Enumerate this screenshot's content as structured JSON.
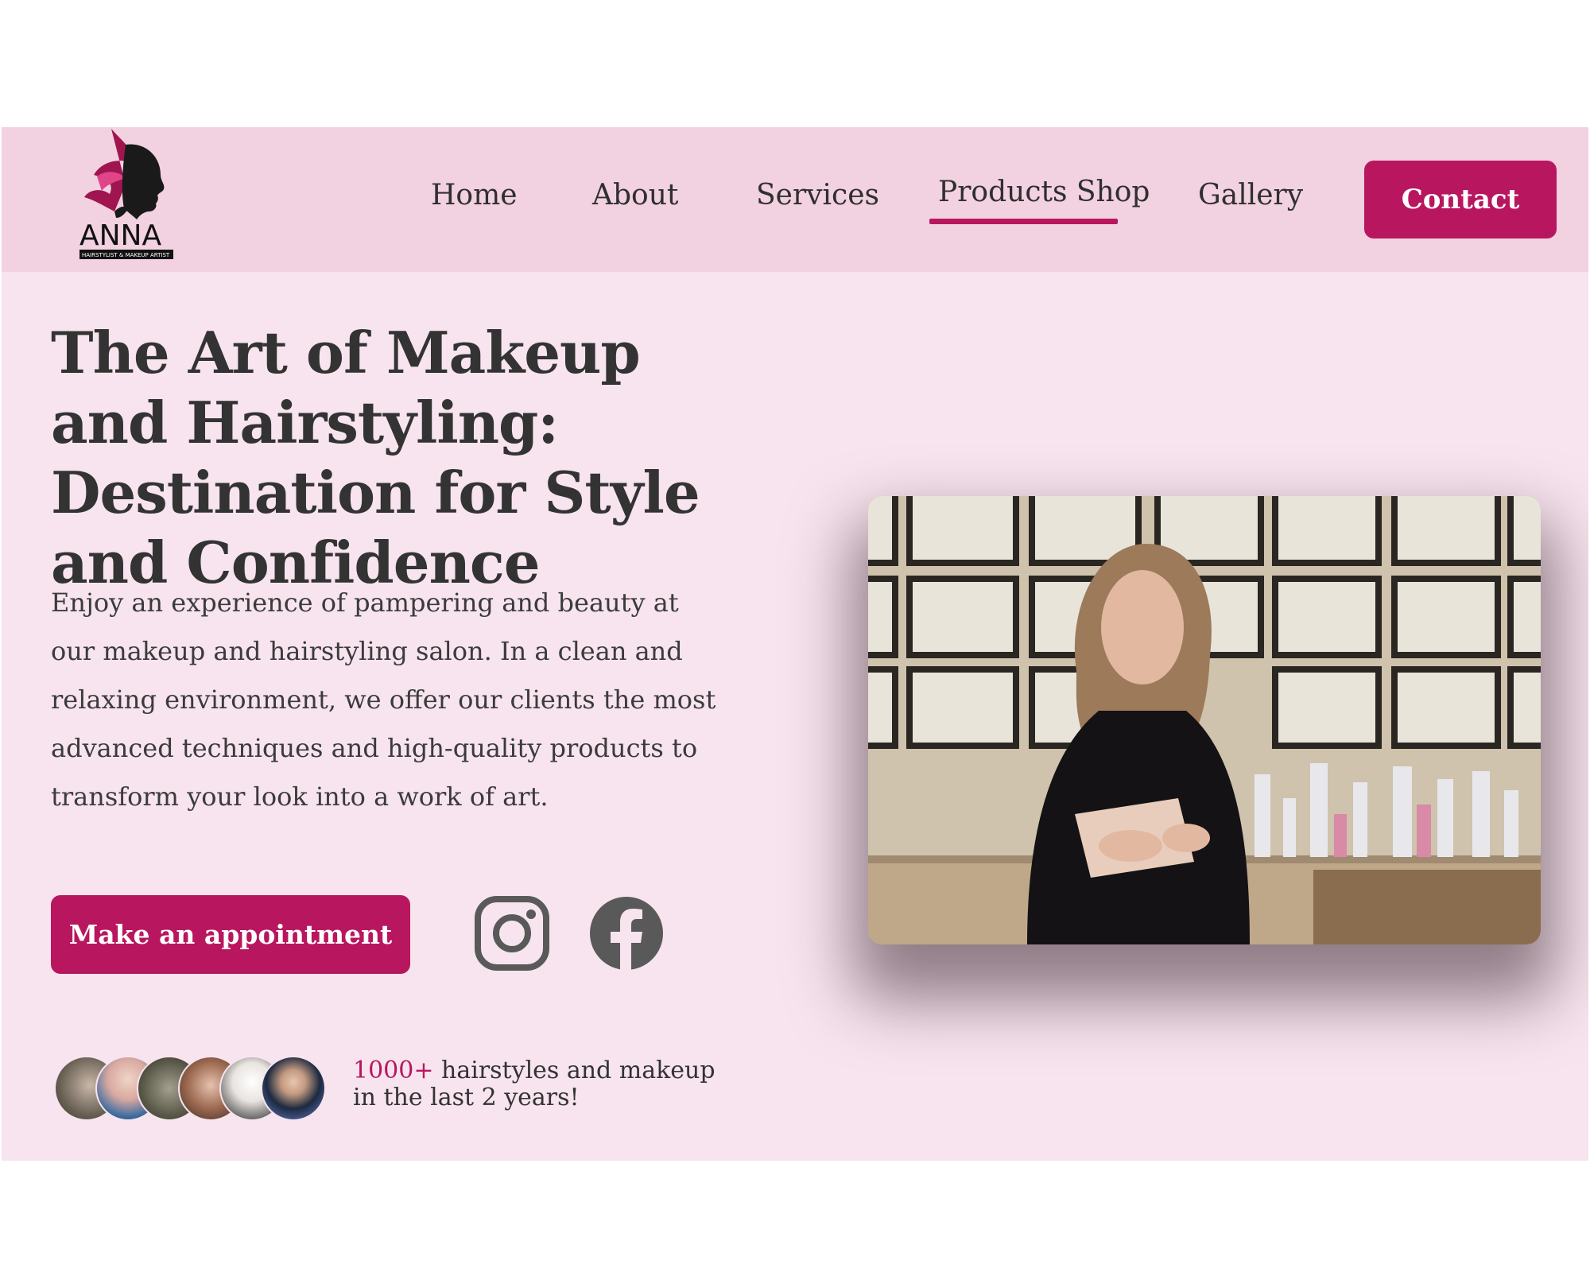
{
  "brand": {
    "name": "ANNA",
    "tagline": "HAIRSTYLIST & MAKEUP ARTIST",
    "accent_color": "#b8175f",
    "nav_bg_color": "#f2d1e0",
    "page_bg_color": "#f7e4ee"
  },
  "nav": {
    "items": [
      {
        "label": "Home",
        "active": false
      },
      {
        "label": "About",
        "active": false
      },
      {
        "label": "Services",
        "active": false
      },
      {
        "label": "Products Shop",
        "active": true
      },
      {
        "label": "Gallery",
        "active": false
      }
    ],
    "contact_label": "Contact"
  },
  "hero": {
    "title": "The Art of Makeup and Hairstyling: Destination for Style and Confidence",
    "description": "Enjoy an experience of pampering and beauty at our makeup and hairstyling salon. In a clean and relaxing environment, we offer our clients the most advanced techniques and high-quality products to transform your look into a work of art.",
    "cta_label": "Make an appointment",
    "social": [
      "instagram-icon",
      "facebook-icon"
    ],
    "photo_icon": "stylist-portrait-photo"
  },
  "stats": {
    "highlight": "1000+",
    "text": " hairstyles and makeup in the last 2 years!",
    "avatar_count": 6
  }
}
